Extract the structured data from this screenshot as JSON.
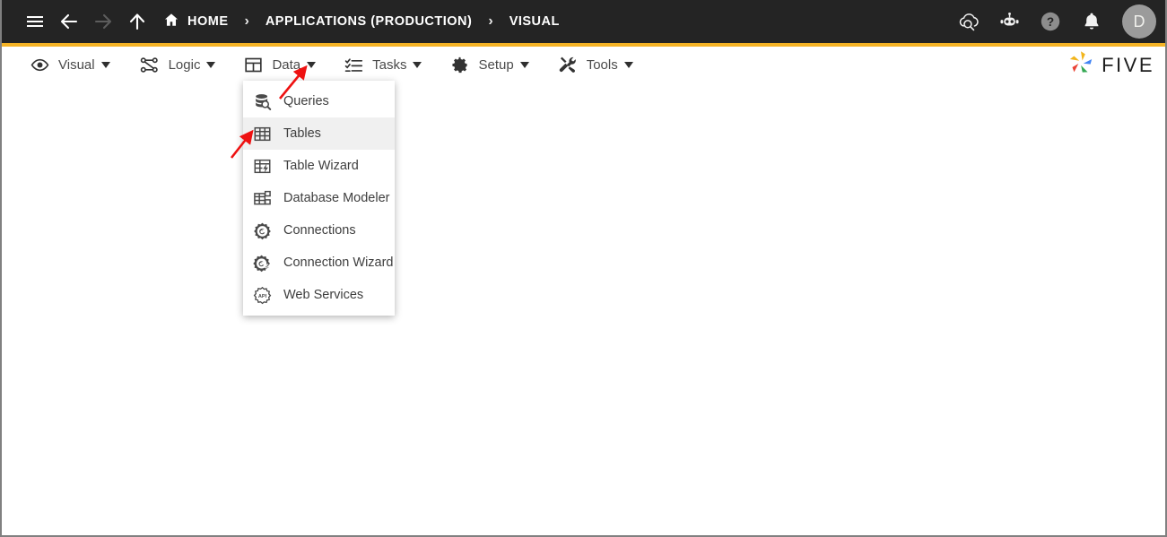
{
  "window": {
    "accent_color": "#f5b325",
    "topbar_color": "#242424"
  },
  "topbar": {
    "nav": [
      {
        "name": "menu-icon",
        "label": "Menu"
      },
      {
        "name": "back-icon",
        "label": "Back"
      },
      {
        "name": "forward-icon",
        "label": "Forward"
      },
      {
        "name": "up-icon",
        "label": "Up"
      }
    ],
    "breadcrumb": [
      {
        "label": "HOME",
        "icon": "home-icon"
      },
      {
        "label": "APPLICATIONS (PRODUCTION)",
        "icon": ""
      },
      {
        "label": "VISUAL",
        "icon": ""
      }
    ],
    "separator": "›",
    "actions": [
      {
        "name": "cloud-search-icon",
        "label": "Cloud Search"
      },
      {
        "name": "robot-icon",
        "label": "Assistant"
      },
      {
        "name": "help-icon",
        "label": "Help"
      },
      {
        "name": "bell-icon",
        "label": "Notifications"
      }
    ],
    "avatar": {
      "initial": "D",
      "label": "User Profile"
    }
  },
  "menubar": {
    "items": [
      {
        "label": "Visual",
        "icon": "eye-icon",
        "caret": true,
        "active": false
      },
      {
        "label": "Logic",
        "icon": "logic-nodes-icon",
        "caret": true,
        "active": false
      },
      {
        "label": "Data",
        "icon": "table-grid-icon",
        "caret": true,
        "active": true
      },
      {
        "label": "Tasks",
        "icon": "checklist-icon",
        "caret": true,
        "active": false
      },
      {
        "label": "Setup",
        "icon": "gear-icon",
        "caret": true,
        "active": false
      },
      {
        "label": "Tools",
        "icon": "tools-icon",
        "caret": true,
        "active": false
      }
    ]
  },
  "brand": {
    "name": "FIVE",
    "logo_colors": [
      "#f2b51c",
      "#4285f4",
      "#ea4335",
      "#34a853",
      "#f2b51c"
    ]
  },
  "dropdown": {
    "owner": "Data",
    "items": [
      {
        "label": "Queries",
        "icon": "database-search-icon",
        "highlighted": false
      },
      {
        "label": "Tables",
        "icon": "table-grid-icon",
        "highlighted": true
      },
      {
        "label": "Table Wizard",
        "icon": "table-wizard-icon",
        "highlighted": false
      },
      {
        "label": "Database Modeler",
        "icon": "database-modeler-icon",
        "highlighted": false
      },
      {
        "label": "Connections",
        "icon": "connection-icon",
        "highlighted": false
      },
      {
        "label": "Connection Wizard",
        "icon": "connection-wizard-icon",
        "highlighted": false
      },
      {
        "label": "Web Services",
        "icon": "api-icon",
        "highlighted": false
      }
    ]
  },
  "annotations": {
    "color": "#ee1111",
    "arrows": [
      {
        "name": "arrow-pointing-to-data-menu",
        "target": "Data menu caret"
      },
      {
        "name": "arrow-pointing-to-tables-item",
        "target": "Tables menu item"
      }
    ]
  }
}
